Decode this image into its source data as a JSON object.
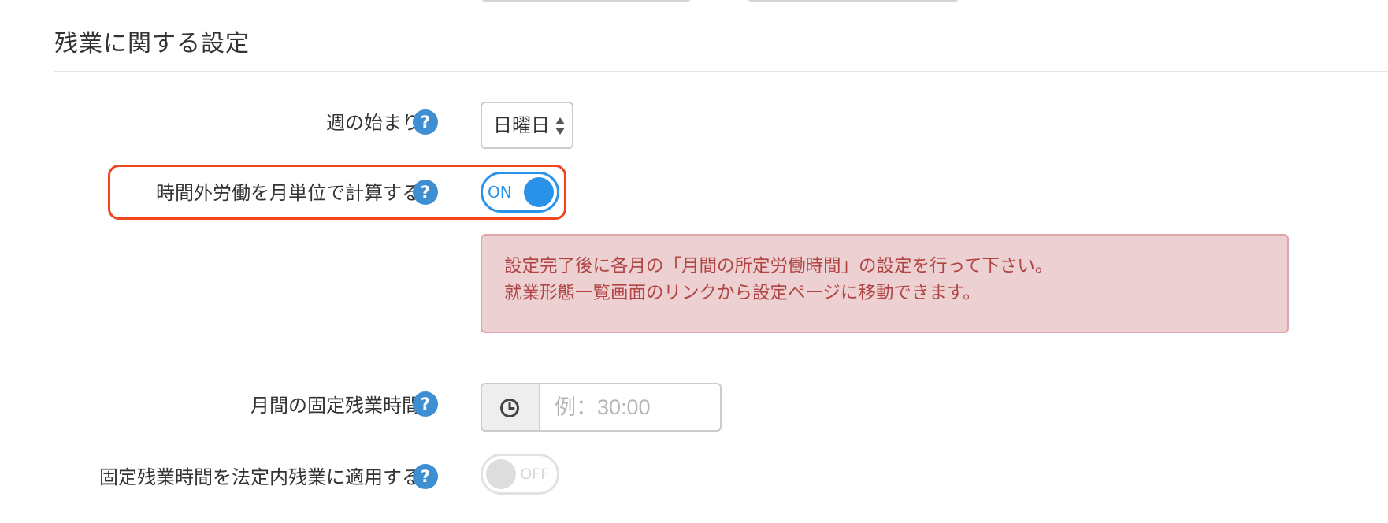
{
  "section": {
    "title": "残業に関する設定"
  },
  "week_start": {
    "label": "週の始まり",
    "help": "?",
    "selected": "日曜日"
  },
  "monthly_overtime": {
    "label": "時間外労働を月単位で計算する",
    "help": "?",
    "toggle_state": "ON",
    "enabled": true
  },
  "alert": {
    "line1": "設定完了後に各月の「月間の所定労働時間」の設定を行って下さい。",
    "line2": "就業形態一覧画面のリンクから設定ページに移動できます。"
  },
  "fixed_overtime": {
    "label": "月間の固定残業時間",
    "help": "?",
    "value": "",
    "placeholder": "例：30:00"
  },
  "apply_fixed_overtime": {
    "label": "固定残業時間を法定内残業に適用する",
    "help": "?",
    "toggle_state": "OFF",
    "enabled": false
  },
  "colors": {
    "accent": "#2a93e9",
    "help_icon": "#3d8fd1",
    "highlight_border": "#f0461e",
    "alert_bg": "#ecd0d2",
    "alert_text": "#b04543"
  }
}
